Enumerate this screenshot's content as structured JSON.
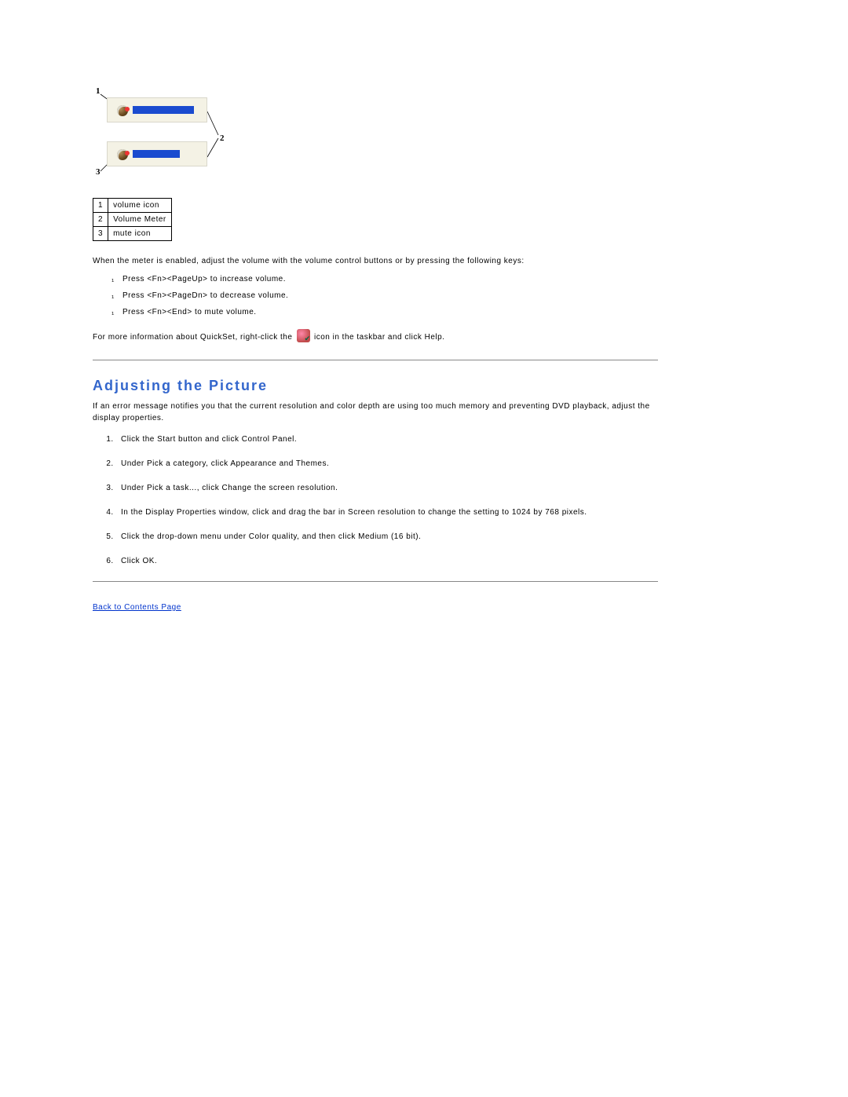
{
  "diagram": {
    "labels": {
      "n1": "1",
      "n2": "2",
      "n3": "3"
    }
  },
  "legend": {
    "rows": [
      {
        "num": "1",
        "text": "volume icon"
      },
      {
        "num": "2",
        "text": "Volume Meter"
      },
      {
        "num": "3",
        "text": "mute icon"
      }
    ]
  },
  "intro": "When the meter is enabled, adjust the volume with the volume control buttons or by pressing the following keys:",
  "keys": [
    "Press <Fn><PageUp> to increase volume.",
    "Press <Fn><PageDn> to decrease volume.",
    "Press <Fn><End> to mute volume."
  ],
  "quickset_before": "For more information about QuickSet, right-click the",
  "quickset_after": "icon in the taskbar and click Help.",
  "section_title": "Adjusting the Picture",
  "picture_intro": "If an error message notifies you that the current resolution and color depth are using too much memory and preventing DVD playback, adjust the display properties.",
  "steps": [
    "Click the Start button and click Control Panel.",
    "Under Pick a category, click Appearance and Themes.",
    "Under Pick a task..., click Change the screen resolution.",
    "In the Display Properties window, click and drag the bar in Screen resolution to change the setting to 1024 by 768 pixels.",
    "Click the drop-down menu under Color quality, and then click Medium (16 bit).",
    "Click OK."
  ],
  "back_link": "Back to Contents Page"
}
